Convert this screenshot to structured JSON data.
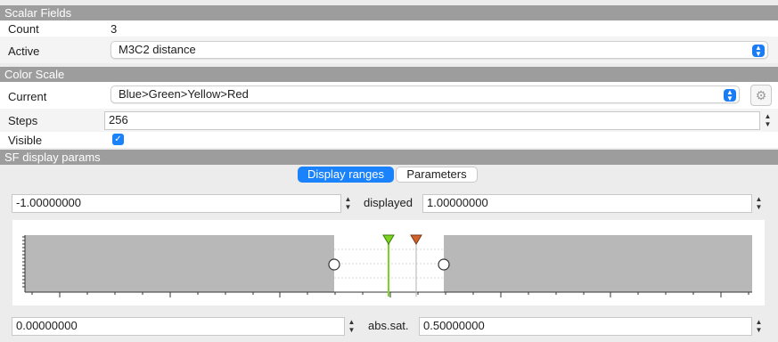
{
  "scalar_fields": {
    "header": "Scalar Fields",
    "count_label": "Count",
    "count_value": "3",
    "active_label": "Active",
    "active_value": "M3C2 distance"
  },
  "color_scale": {
    "header": "Color Scale",
    "current_label": "Current",
    "current_value": "Blue>Green>Yellow>Red",
    "steps_label": "Steps",
    "steps_value": "256",
    "visible_label": "Visible",
    "visible_checked": true
  },
  "sf_display": {
    "header": "SF display params",
    "tabs": [
      {
        "label": "Display ranges",
        "active": true
      },
      {
        "label": "Parameters",
        "active": false
      }
    ],
    "displayed_min": "-1.00000000",
    "displayed_label": "displayed",
    "displayed_max": "1.00000000",
    "sat_min": "0.00000000",
    "sat_label": "abs.sat.",
    "sat_max": "0.50000000"
  },
  "colors": {
    "accent": "#1a82fb",
    "header_bg": "#9d9d9d",
    "histogram_gray": "#b8b8b8",
    "green_marker": "#7ed321",
    "orange_marker": "#d0642b"
  },
  "icons": {
    "combo_chevron": "chevron-updown-icon",
    "gear": "gear-icon",
    "checkbox": "checkmark-icon"
  }
}
